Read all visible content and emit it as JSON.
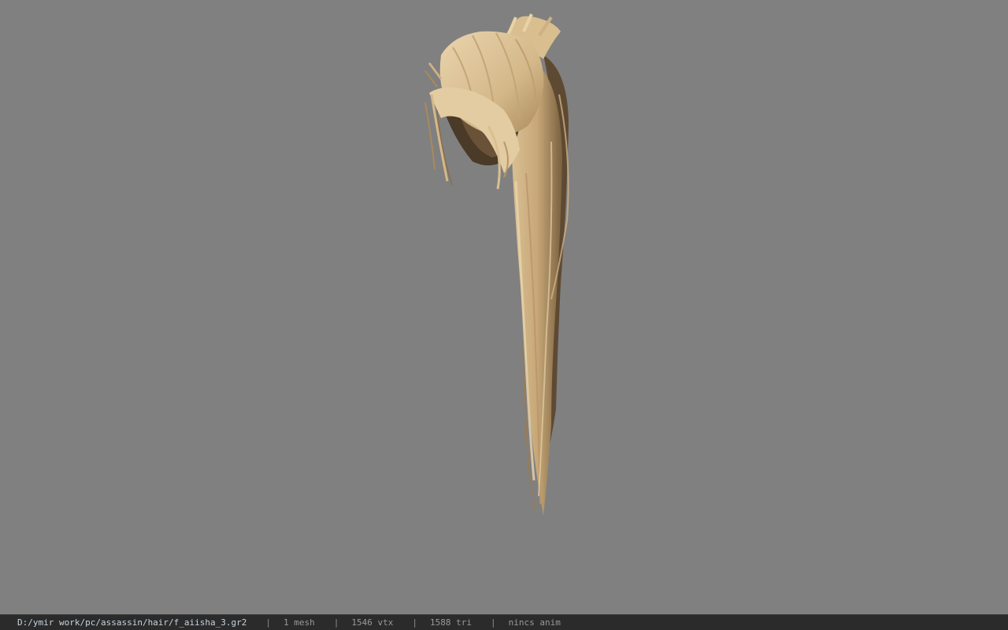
{
  "statusbar": {
    "file_path": "D:/ymir work/pc/assassin/hair/f_aiisha_3.gr2",
    "separator": "|",
    "mesh_count": "1 mesh",
    "vertex_count": "1546 vtx",
    "triangle_count": "1588 tri",
    "anim_status": "nincs anim"
  },
  "viewport": {
    "background_color": "#808080",
    "model_color_light": "#e2c9a0",
    "model_color_mid": "#c9a977",
    "model_color_dark": "#5a4630"
  }
}
